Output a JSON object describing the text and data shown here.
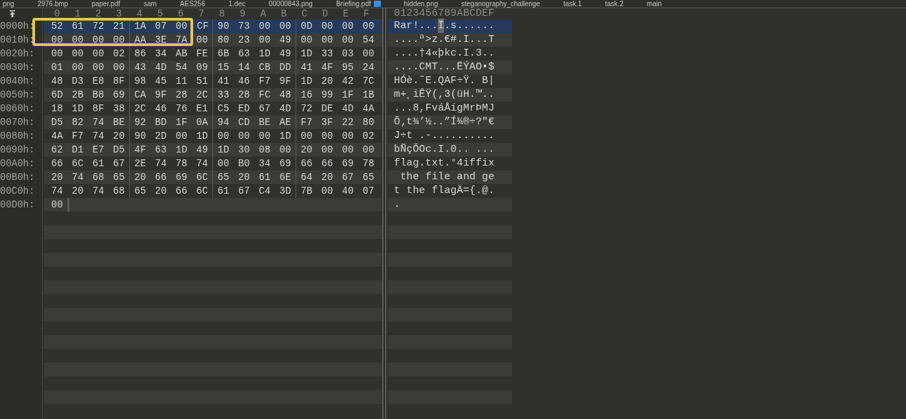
{
  "tabs": [
    {
      "label": "png",
      "selected": false,
      "modified": false
    },
    {
      "label": "2976.bmp",
      "selected": false,
      "modified": false
    },
    {
      "label": "paper.pdf",
      "selected": false,
      "modified": false
    },
    {
      "label": "sam",
      "selected": false,
      "modified": false
    },
    {
      "label": "AES256",
      "selected": false,
      "modified": false
    },
    {
      "label": "1.dec",
      "selected": false,
      "modified": false
    },
    {
      "label": "00000843.png",
      "selected": false,
      "modified": false
    },
    {
      "label": "Briefing.pdf",
      "selected": false,
      "modified": true
    },
    {
      "label": "hidden.png",
      "selected": false,
      "modified": false
    },
    {
      "label": "steganography_challenge",
      "selected": false,
      "modified": false
    },
    {
      "label": "task.1",
      "selected": false,
      "modified": false
    },
    {
      "label": "task.2",
      "selected": false,
      "modified": false
    },
    {
      "label": "main",
      "selected": false,
      "modified": false
    }
  ],
  "columns": [
    "0",
    "1",
    "2",
    "3",
    "4",
    "5",
    "6",
    "7",
    "8",
    "9",
    "A",
    "B",
    "C",
    "D",
    "E",
    "F"
  ],
  "ascii_header": "0123456789ABCDEF",
  "rows": [
    {
      "offset": "0000h:",
      "selected": true,
      "bytes": [
        "52",
        "61",
        "72",
        "21",
        "1A",
        "07",
        "00",
        {
          "hex": "CF",
          "cursor": true
        },
        "90",
        "73",
        "00",
        "00",
        "0D",
        "00",
        "00",
        "00"
      ],
      "ascii": [
        "Rar!...",
        {
          "text": "Ï",
          "cursor": true
        },
        ".s......"
      ]
    },
    {
      "offset": "0010h:",
      "selected": false,
      "bytes": [
        "00",
        "00",
        "00",
        "00",
        "AA",
        "3E",
        "7A",
        "00",
        "80",
        "23",
        "00",
        "49",
        "00",
        "00",
        "00",
        "54"
      ],
      "ascii": [
        "....ª>z.€#.I...T"
      ]
    },
    {
      "offset": "0020h:",
      "selected": false,
      "bytes": [
        "00",
        "00",
        "00",
        "02",
        "86",
        "34",
        "AB",
        "FE",
        "6B",
        "63",
        "1D",
        "49",
        "1D",
        "33",
        "03",
        "00"
      ],
      "ascii": [
        "....†4«þkc.I.3.."
      ]
    },
    {
      "offset": "0030h:",
      "selected": false,
      "bytes": [
        "01",
        "00",
        "00",
        "00",
        "43",
        "4D",
        "54",
        "09",
        "15",
        "14",
        "CB",
        "DD",
        "41",
        "4F",
        "95",
        "24"
      ],
      "ascii": [
        "....CMT...ËÝAO•$"
      ]
    },
    {
      "offset": "0040h:",
      "selected": false,
      "bytes": [
        "48",
        "D3",
        "E8",
        "8F",
        "98",
        "45",
        "11",
        "51",
        "41",
        "46",
        "F7",
        "9F",
        "1D",
        "20",
        "42",
        "7C"
      ],
      "ascii": [
        "HÓè.˜E.QAF÷Ÿ. B|"
      ]
    },
    {
      "offset": "0050h:",
      "selected": false,
      "bytes": [
        "6D",
        "2B",
        "B8",
        "69",
        "CA",
        "9F",
        "28",
        "2C",
        "33",
        "28",
        "FC",
        "48",
        "16",
        "99",
        "1F",
        "1B"
      ],
      "ascii": [
        "m+¸iÊŸ(,3(üH.™.."
      ]
    },
    {
      "offset": "0060h:",
      "selected": false,
      "bytes": [
        "18",
        "1D",
        "8F",
        "38",
        "2C",
        "46",
        "76",
        "E1",
        "C5",
        "ED",
        "67",
        "4D",
        "72",
        "DE",
        "4D",
        "4A"
      ],
      "ascii": [
        "...8,FváÅígMrÞMJ"
      ]
    },
    {
      "offset": "0070h:",
      "selected": false,
      "bytes": [
        "D5",
        "82",
        "74",
        "BE",
        "92",
        "BD",
        "1F",
        "0A",
        "94",
        "CD",
        "BE",
        "AE",
        "F7",
        "3F",
        "22",
        "80"
      ],
      "ascii": [
        "Õ‚t¾’½..”Í¾®÷?\"€"
      ]
    },
    {
      "offset": "0080h:",
      "selected": false,
      "bytes": [
        "4A",
        "F7",
        "74",
        "20",
        "90",
        "2D",
        "00",
        "1D",
        "00",
        "00",
        "00",
        "1D",
        "00",
        "00",
        "00",
        "02"
      ],
      "ascii": [
        "J÷t .-.........."
      ]
    },
    {
      "offset": "0090h:",
      "selected": false,
      "bytes": [
        "62",
        "D1",
        "E7",
        "D5",
        "4F",
        "63",
        "1D",
        "49",
        "1D",
        "30",
        "08",
        "00",
        "20",
        "00",
        "00",
        "00"
      ],
      "ascii": [
        "bÑçÕOc.I.0.. ..."
      ]
    },
    {
      "offset": "00A0h:",
      "selected": false,
      "bytes": [
        "66",
        "6C",
        "61",
        "67",
        "2E",
        "74",
        "78",
        "74",
        "00",
        "B0",
        "34",
        "69",
        "66",
        "66",
        "69",
        "78"
      ],
      "ascii": [
        "flag.txt.°4iffix"
      ]
    },
    {
      "offset": "00B0h:",
      "selected": false,
      "bytes": [
        "20",
        "74",
        "68",
        "65",
        "20",
        "66",
        "69",
        "6C",
        "65",
        "20",
        "61",
        "6E",
        "64",
        "20",
        "67",
        "65"
      ],
      "ascii": [
        " the file and ge"
      ]
    },
    {
      "offset": "00C0h:",
      "selected": false,
      "bytes": [
        "74",
        "20",
        "74",
        "68",
        "65",
        "20",
        "66",
        "6C",
        "61",
        "67",
        "C4",
        "3D",
        "7B",
        "00",
        "40",
        "07"
      ],
      "ascii": [
        "t the flagÄ={.@."
      ]
    },
    {
      "offset": "00D0h:",
      "selected": false,
      "bytes": [
        "00"
      ],
      "ascii": [
        "."
      ]
    }
  ]
}
